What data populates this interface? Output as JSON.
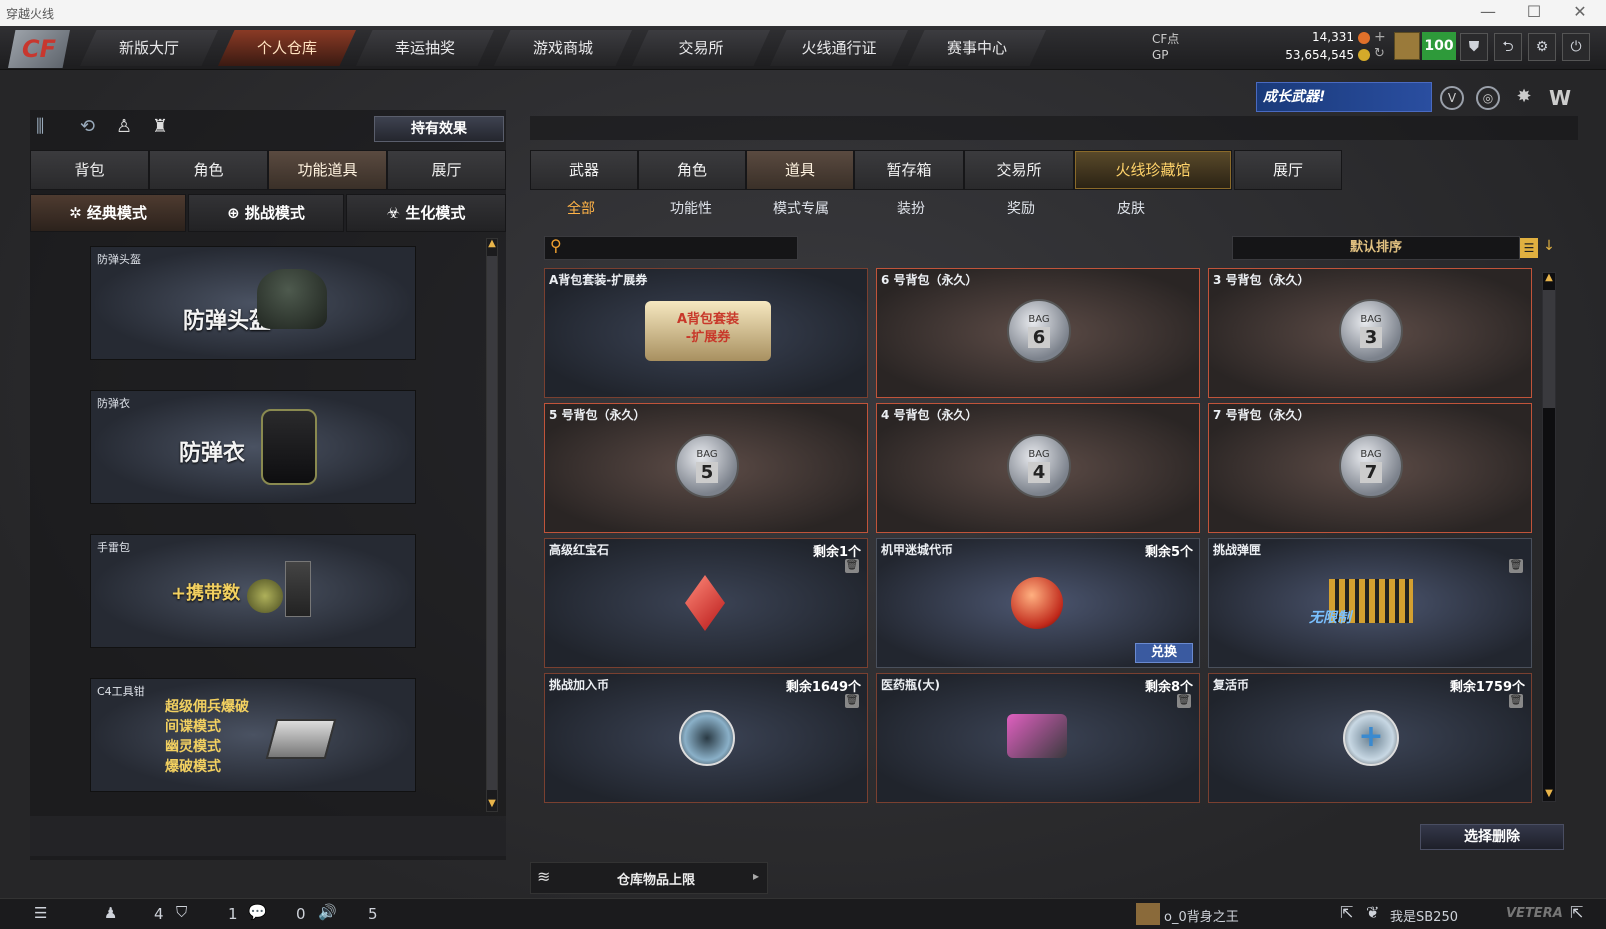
{
  "window": {
    "title": "穿越火线",
    "minimize": "—",
    "maximize": "☐",
    "close": "✕"
  },
  "logo": "CF",
  "nav": [
    "新版大厅",
    "个人仓库",
    "幸运抽奖",
    "游戏商城",
    "交易所",
    "火线通行证",
    "赛事中心"
  ],
  "currency": {
    "cf_label": "CF点",
    "cf_value": "14,331",
    "gp_label": "GP",
    "gp_value": "53,654,545",
    "level": "100"
  },
  "banner": "成长武器!",
  "left": {
    "effect_button": "持有效果",
    "tabs": [
      "背包",
      "角色",
      "功能道具",
      "展厅"
    ],
    "modes": [
      "经典模式",
      "挑战模式",
      "生化模式"
    ],
    "cards": [
      {
        "title": "防弹头盔",
        "big": "防弹头盔"
      },
      {
        "title": "防弹衣",
        "big": "防弹衣"
      },
      {
        "title": "手雷包",
        "big": "+携带数"
      },
      {
        "title": "C4工具钳",
        "lines": [
          "超级佣兵爆破",
          "间谍模式",
          "幽灵模式",
          "爆破模式"
        ]
      }
    ]
  },
  "right": {
    "tabs": [
      "武器",
      "角色",
      "道具",
      "暂存箱",
      "交易所",
      "火线珍藏馆",
      "展厅"
    ],
    "subtabs": [
      "全部",
      "功能性",
      "模式专属",
      "装扮",
      "奖励",
      "皮肤"
    ],
    "search_placeholder": "",
    "sort": "默认排序",
    "items": [
      {
        "name": "A背包套装-扩展券",
        "count": "",
        "art": "A背包套装\n-扩展券"
      },
      {
        "name": "6 号背包（永久）",
        "count": "",
        "bag": "6"
      },
      {
        "name": "3 号背包（永久）",
        "count": "",
        "bag": "3"
      },
      {
        "name": "5 号背包（永久）",
        "count": "",
        "bag": "5"
      },
      {
        "name": "4 号背包（永久）",
        "count": "",
        "bag": "4"
      },
      {
        "name": "7 号背包（永久）",
        "count": "",
        "bag": "7"
      },
      {
        "name": "高级红宝石",
        "count": "剩余1个"
      },
      {
        "name": "机甲迷城代币",
        "count": "剩余5个",
        "action": "兑换"
      },
      {
        "name": "挑战弹匣",
        "count": "",
        "art": "无限制"
      },
      {
        "name": "挑战加入币",
        "count": "剩余1649个"
      },
      {
        "name": "医药瓶(大)",
        "count": "剩余8个"
      },
      {
        "name": "复活币",
        "count": "剩余1759个"
      }
    ],
    "bag_label": "BAG",
    "delete_button": "选择删除",
    "storage_limit": "仓库物品上限"
  },
  "status": {
    "a": "4",
    "b": "1",
    "c": "0",
    "d": "5",
    "friend1": "o_0背身之王",
    "friend2": "我是SB250",
    "veteran": "VETERA"
  },
  "colors": {
    "accent": "#ffb347",
    "item_border": "#c1543a",
    "level": "#2e9a3a"
  }
}
